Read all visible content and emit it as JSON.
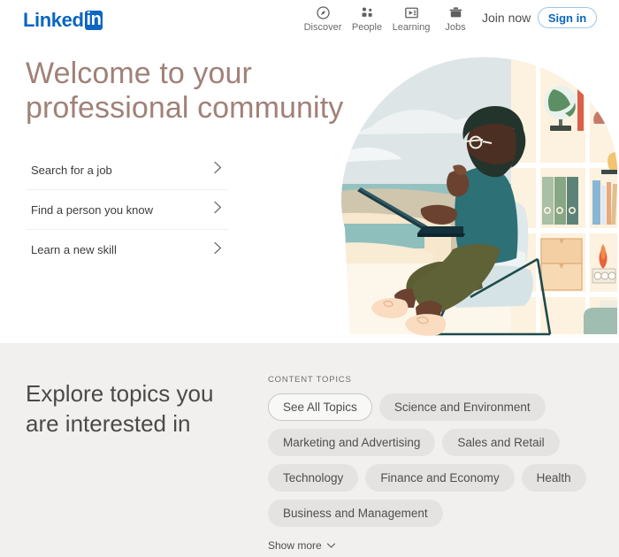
{
  "brand": {
    "logo_word": "Linked",
    "logo_box": "in",
    "accent_color": "#0a66c2",
    "hero_title_color": "#a08178",
    "topics_bg_color": "#f1f0ee",
    "pill_bg_color": "#e4e3e1"
  },
  "header": {
    "nav": [
      {
        "label": "Discover",
        "icon": "compass-icon"
      },
      {
        "label": "People",
        "icon": "people-icon"
      },
      {
        "label": "Learning",
        "icon": "learning-icon"
      },
      {
        "label": "Jobs",
        "icon": "briefcase-icon"
      }
    ],
    "join_now_label": "Join now",
    "sign_in_label": "Sign in"
  },
  "hero": {
    "title_line1": "Welcome to your",
    "title_line2": "professional community",
    "links": [
      {
        "label": "Search for a job",
        "icon": "chevron-right-icon"
      },
      {
        "label": "Find a person you know",
        "icon": "chevron-right-icon"
      },
      {
        "label": "Learn a new skill",
        "icon": "chevron-right-icon"
      }
    ],
    "illustration_alt": "person-with-laptop-illustration"
  },
  "topics": {
    "title_line1": "Explore topics you",
    "title_line2": "are interested in",
    "section_label": "CONTENT TOPICS",
    "pills": [
      {
        "label": "See All Topics",
        "style": "outline"
      },
      {
        "label": "Science and Environment",
        "style": "filled"
      },
      {
        "label": "Marketing and Advertising",
        "style": "filled"
      },
      {
        "label": "Sales and Retail",
        "style": "filled"
      },
      {
        "label": "Technology",
        "style": "filled"
      },
      {
        "label": "Finance and Economy",
        "style": "filled"
      },
      {
        "label": "Health",
        "style": "filled"
      },
      {
        "label": "Business and Management",
        "style": "filled"
      }
    ],
    "show_more_label": "Show more",
    "show_more_icon": "chevron-down-icon"
  }
}
